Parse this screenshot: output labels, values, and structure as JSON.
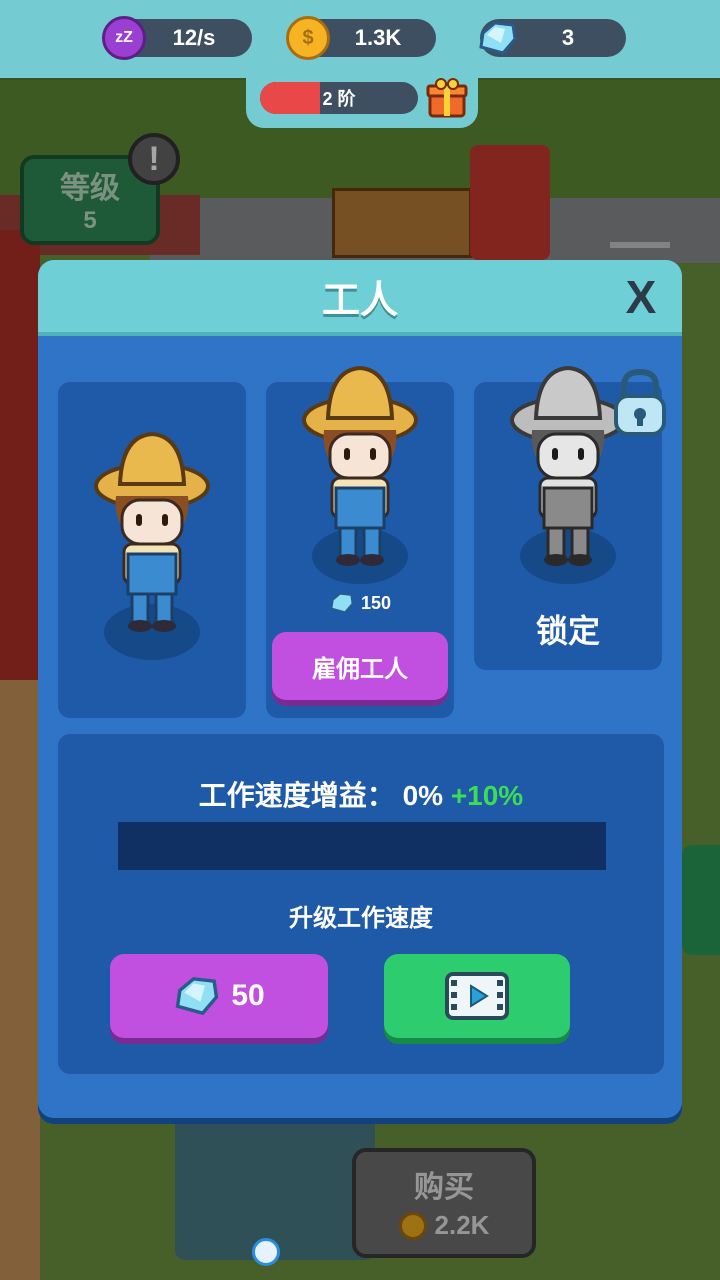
{
  "top_bar": {
    "sleep_rate": "12/s",
    "coins": "1.3K",
    "gems": "3",
    "stage_label": "2 阶",
    "stage_progress": 0.38
  },
  "level_badge": {
    "label": "等级",
    "value": "5"
  },
  "modal": {
    "title": "工人",
    "close_label": "X",
    "hire_cost": "150",
    "hire_button": "雇佣工人",
    "locked_label": "锁定",
    "speed_label": "工作速度增益：",
    "speed_current": "0%",
    "speed_bonus": "+10%",
    "speed_progress": 0,
    "upgrade_title": "升级工作速度",
    "upgrade_cost": "50"
  },
  "buy_button": {
    "label": "购买",
    "price": "2.2K"
  },
  "colors": {
    "accent_purple": "#c14fe0",
    "accent_green": "#2dcc6e",
    "panel_blue": "#1e5aa8",
    "header_teal": "#6ed0d6"
  }
}
